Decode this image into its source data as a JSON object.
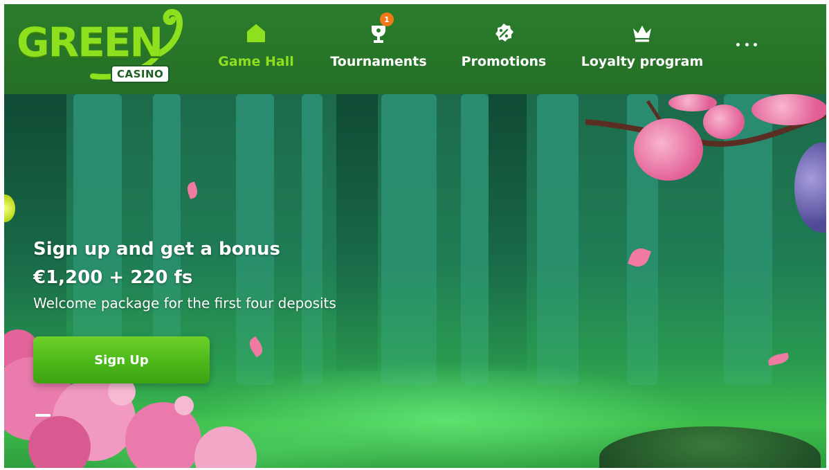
{
  "logo": {
    "word": "GREEN",
    "badge": "CASINO"
  },
  "nav": {
    "items": [
      {
        "label": "Game Hall",
        "icon": "home-icon",
        "active": true
      },
      {
        "label": "Tournaments",
        "icon": "trophy-icon",
        "badge": "1"
      },
      {
        "label": "Promotions",
        "icon": "percent-badge-icon"
      },
      {
        "label": "Loyalty program",
        "icon": "crown-icon"
      }
    ],
    "more_icon": "more-dots-icon"
  },
  "hero": {
    "title_line1": "Sign up and get a bonus",
    "title_line2": "€1,200 + 220 fs",
    "subtitle": "Welcome package for the first four deposits",
    "cta_label": "Sign Up"
  },
  "colors": {
    "header_bg": "#2b7d2c",
    "accent_green": "#8ee01f",
    "button_green": "#4bb81a",
    "badge_orange": "#f07a1a"
  }
}
